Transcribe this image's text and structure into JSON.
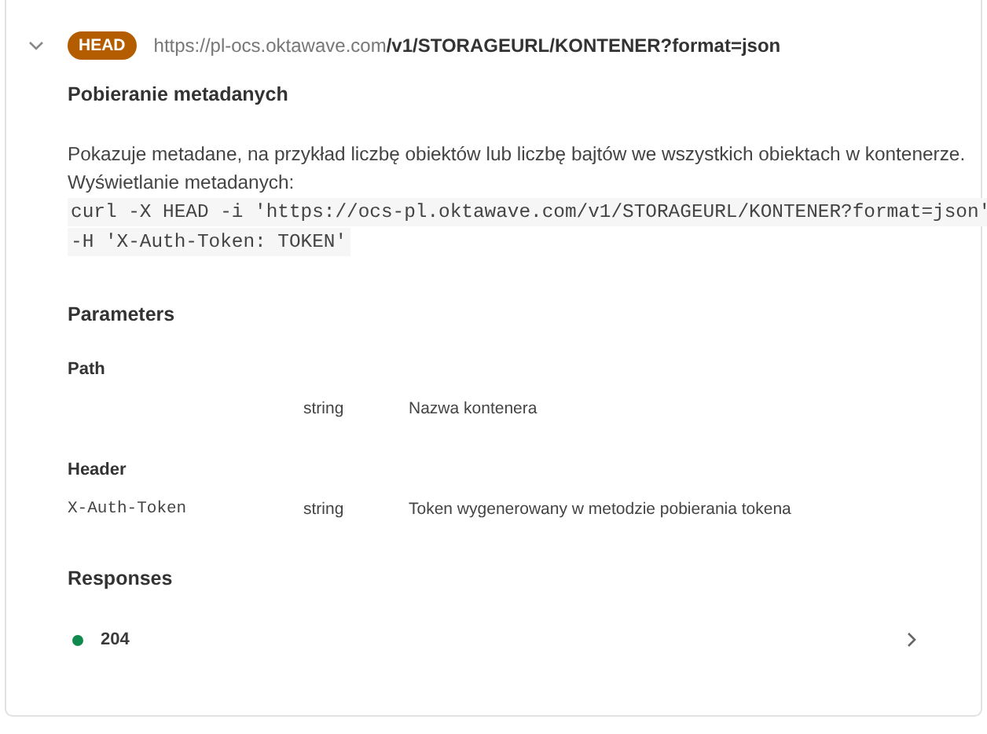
{
  "endpoint": {
    "expanded": true,
    "method": "HEAD",
    "url_base": "https://pl-ocs.oktawave.com",
    "url_path": "/v1/STORAGEURL/KONTENER?format=json",
    "title": "Pobieranie metadanych",
    "description": [
      "Pokazuje metadane, na przykład liczbę obiektów lub liczbę bajtów we wszystkich obiektach w kontenerze.",
      "Wyświetlanie metadanych:"
    ],
    "code_lines": [
      "curl -X HEAD -i 'https://ocs-pl.oktawave.com/v1/STORAGEURL/KONTENER?format=json'",
      "-H 'X-Auth-Token: TOKEN'"
    ],
    "parameters_heading": "Parameters",
    "parameter_groups": [
      {
        "title": "Path",
        "params": [
          {
            "type": "string",
            "description": "Nazwa kontenera"
          }
        ]
      },
      {
        "title": "Header",
        "params": [
          {
            "name": "X-Auth-Token",
            "type": "string",
            "description": "Token wygenerowany w metodzie pobierania tokena"
          }
        ]
      }
    ],
    "responses_heading": "Responses",
    "responses": [
      {
        "code": "204",
        "color": "#0f8a4c"
      }
    ]
  }
}
